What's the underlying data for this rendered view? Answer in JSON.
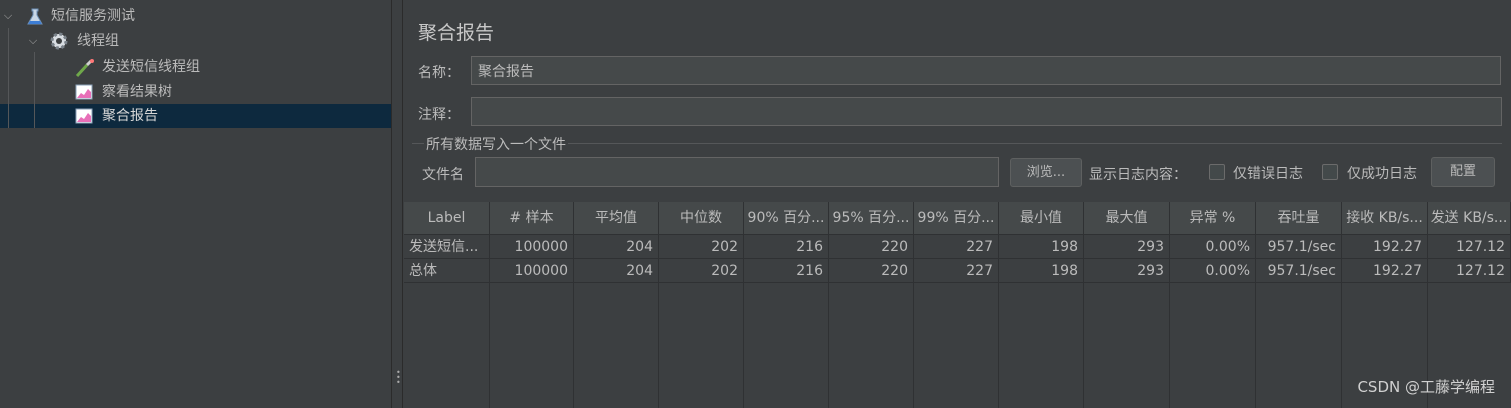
{
  "tree": {
    "items": [
      {
        "label": "短信服务测试",
        "icon": "flask-icon"
      },
      {
        "label": "线程组",
        "icon": "gear-icon"
      },
      {
        "label": "发送短信线程组",
        "icon": "pipette-icon"
      },
      {
        "label": "察看结果树",
        "icon": "chart-icon"
      },
      {
        "label": "聚合报告",
        "icon": "chart-icon"
      }
    ]
  },
  "panel": {
    "title": "聚合报告",
    "name_label": "名称：",
    "name_value": "聚合报告",
    "comment_label": "注释：",
    "comment_value": "",
    "file_group_title": "所有数据写入一个文件",
    "filename_label": "文件名",
    "filename_value": "",
    "browse_button": "浏览...",
    "log_label": "显示日志内容：",
    "errors_only_label": "仅错误日志",
    "success_only_label": "仅成功日志",
    "config_button": "配置"
  },
  "table": {
    "headers": [
      "Label",
      "# 样本",
      "平均值",
      "中位数",
      "90% 百分...",
      "95% 百分...",
      "99% 百分...",
      "最小值",
      "最大值",
      "异常 %",
      "吞吐量",
      "接收 KB/s...",
      "发送 KB/s..."
    ],
    "rows": [
      [
        "发送短信...",
        "100000",
        "204",
        "202",
        "216",
        "220",
        "227",
        "198",
        "293",
        "0.00%",
        "957.1/sec",
        "192.27",
        "127.12"
      ],
      [
        "总体",
        "100000",
        "204",
        "202",
        "216",
        "220",
        "227",
        "198",
        "293",
        "0.00%",
        "957.1/sec",
        "192.27",
        "127.12"
      ]
    ]
  },
  "watermark": "CSDN @工藤学编程",
  "colors": {
    "background": "#3c3f41",
    "selection": "#0d293e",
    "field": "#45494a"
  }
}
